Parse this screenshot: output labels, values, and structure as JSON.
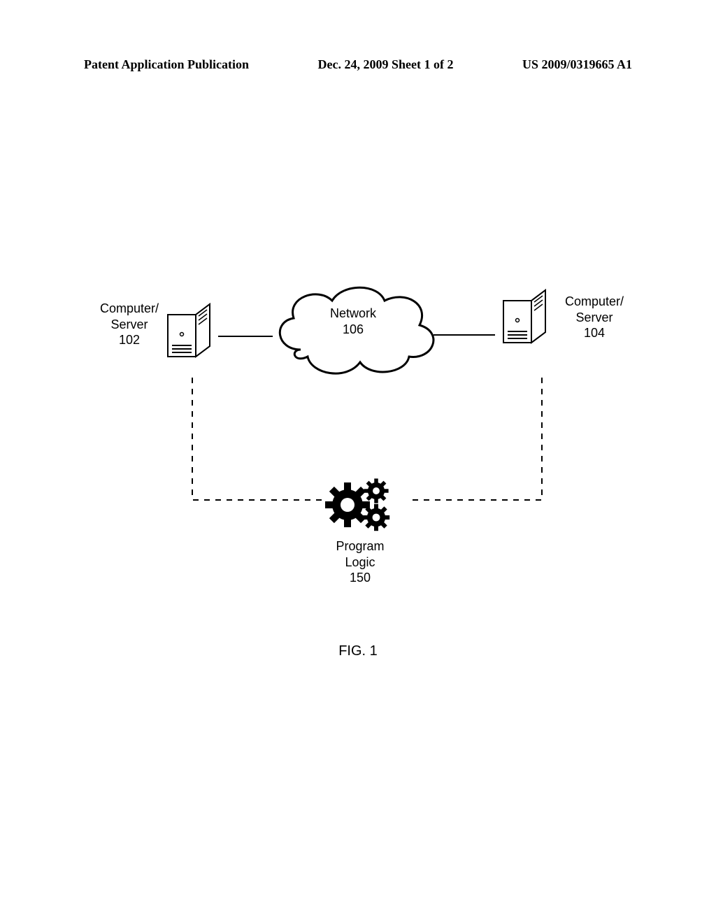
{
  "header": {
    "left": "Patent Application Publication",
    "center": "Dec. 24, 2009  Sheet 1 of 2",
    "right": "US 2009/0319665 A1"
  },
  "diagram": {
    "server_left": {
      "line1": "Computer/",
      "line2": "Server",
      "ref": "102"
    },
    "server_right": {
      "line1": "Computer/",
      "line2": "Server",
      "ref": "104"
    },
    "network": {
      "label": "Network",
      "ref": "106"
    },
    "program": {
      "line1": "Program",
      "line2": "Logic",
      "ref": "150"
    },
    "figure_label": "FIG. 1"
  }
}
